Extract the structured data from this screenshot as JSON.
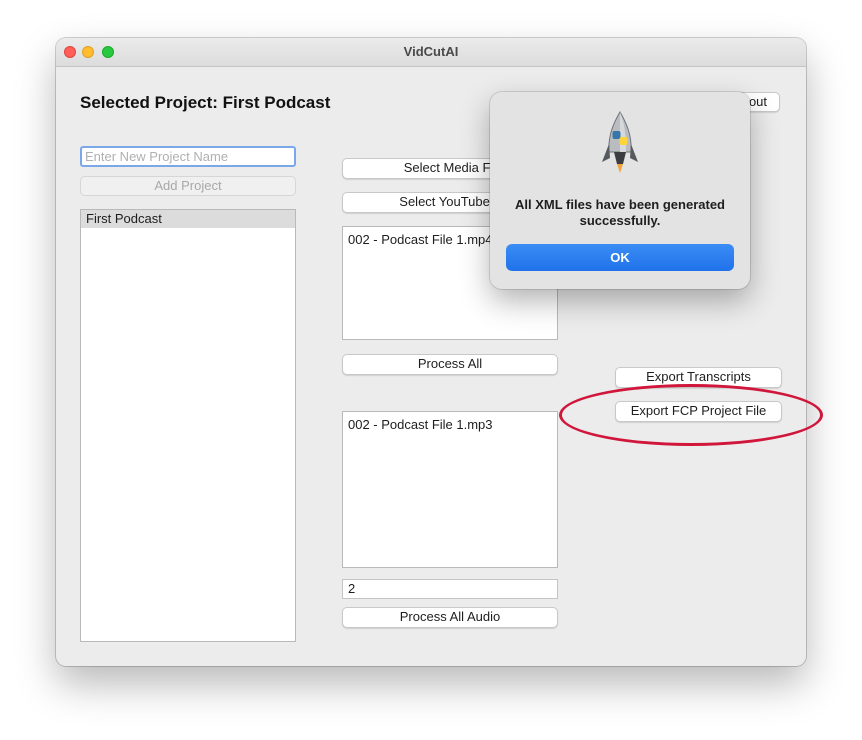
{
  "window": {
    "title": "VidCutAI"
  },
  "header": {
    "selected_project": "Selected Project: First Podcast",
    "about_label": "out"
  },
  "projects": {
    "new_project_placeholder": "Enter New Project Name",
    "add_project_label": "Add Project",
    "items": [
      {
        "label": "First Podcast",
        "selected": true
      }
    ]
  },
  "media": {
    "select_media_label": "Select Media Fil",
    "select_youtube_label": "Select YouTube L",
    "files": [
      "002 - Podcast File 1.mp4"
    ],
    "process_all_label": "Process All"
  },
  "audio": {
    "files": [
      "002 - Podcast File 1.mp3"
    ],
    "count_value": "2",
    "process_all_audio_label": "Process All Audio"
  },
  "export": {
    "transcripts_label": "Export Transcripts",
    "fcp_project_label": "Export FCP Project File"
  },
  "dialog": {
    "icon": "python-launcher-rocket-icon",
    "message": "All XML files have been generated successfully.",
    "ok_label": "OK",
    "accent_color": "#2a7ff0"
  },
  "annotation": {
    "color": "#d0163a",
    "target": "export-fcp-project-button"
  }
}
